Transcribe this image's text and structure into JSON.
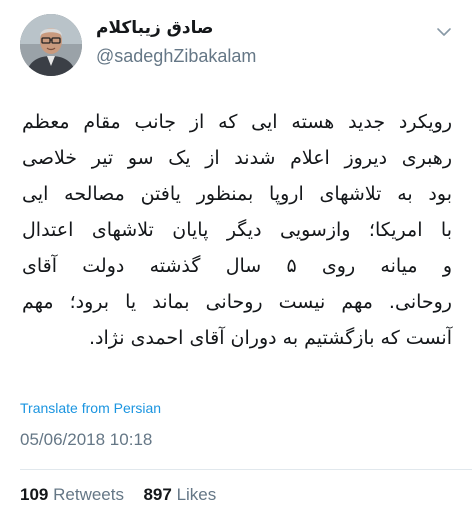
{
  "user": {
    "display_name": "صادق زیباکلام",
    "handle": "@sadeghZibakalam"
  },
  "tweet": {
    "lines": [
      "رویکرد جدید هسته ایی که از جانب مقام معظم",
      "رهبری دیروز اعلام شدند از یک سو تیر خلاصی",
      "بود به تلاشهای اروپا بمنظور یافتن مصالحه ایی",
      "با امریکا؛ وازسویی دیگر پایان تلاشهای اعتدال",
      "و میانه روی ۵ سال گذشته دولت آقای",
      "روحانی. مهم نیست روحانی بماند یا برود؛ مهم",
      "آنست که بازگشتیم به دوران آقای احمدی نژاد."
    ],
    "translate_label": "Translate from Persian",
    "timestamp": "05/06/2018 10:18"
  },
  "stats": {
    "retweets_count": "109",
    "retweets_label": "Retweets",
    "likes_count": "897",
    "likes_label": "Likes"
  },
  "icons": {
    "menu": "chevron-down-icon",
    "avatar": "avatar"
  },
  "colors": {
    "text": "#14171a",
    "muted": "#657786",
    "link": "#1b95e0",
    "divider": "#e1e8ed"
  }
}
